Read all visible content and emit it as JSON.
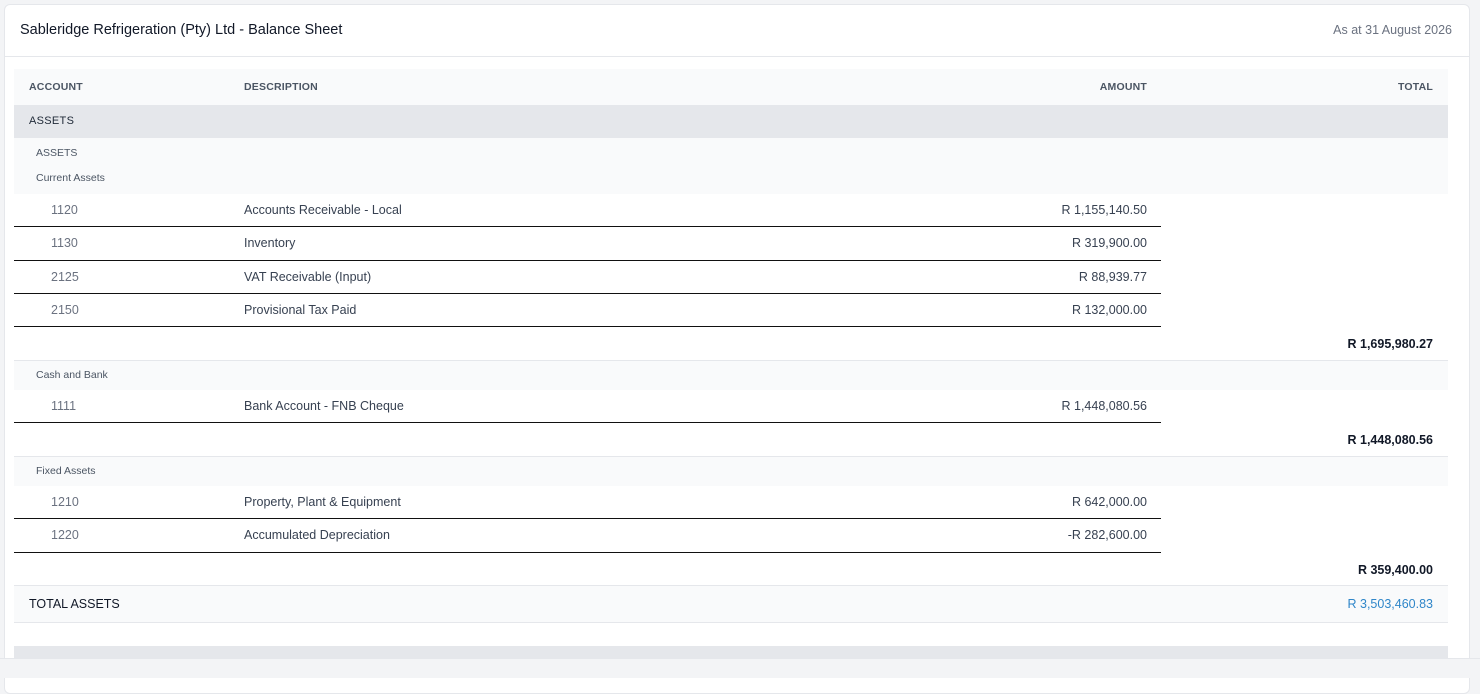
{
  "report": {
    "title": "Sableridge Refrigeration (Pty) Ltd - Balance Sheet",
    "as_at": "As at 31 August 2026"
  },
  "columns": {
    "account": "ACCOUNT",
    "description": "DESCRIPTION",
    "amount": "AMOUNT",
    "total": "TOTAL"
  },
  "assets": {
    "section_label": "ASSETS",
    "group_label": "ASSETS",
    "current": {
      "label": "Current Assets",
      "lines": [
        {
          "account": "1120",
          "description": "Accounts Receivable - Local",
          "amount": "R 1,155,140.50"
        },
        {
          "account": "1130",
          "description": "Inventory",
          "amount": "R 319,900.00"
        },
        {
          "account": "2125",
          "description": "VAT Receivable (Input)",
          "amount": "R 88,939.77"
        },
        {
          "account": "2150",
          "description": "Provisional Tax Paid",
          "amount": "R 132,000.00"
        }
      ],
      "subtotal": "R 1,695,980.27"
    },
    "cash": {
      "label": "Cash and Bank",
      "lines": [
        {
          "account": "1111",
          "description": "Bank Account - FNB Cheque",
          "amount": "R 1,448,080.56"
        }
      ],
      "subtotal": "R 1,448,080.56"
    },
    "fixed": {
      "label": "Fixed Assets",
      "lines": [
        {
          "account": "1210",
          "description": "Property, Plant & Equipment",
          "amount": "R 642,000.00"
        },
        {
          "account": "1220",
          "description": "Accumulated Depreciation",
          "amount": "-R 282,600.00"
        }
      ],
      "subtotal": "R 359,400.00"
    },
    "total_label": "TOTAL ASSETS",
    "total_value": "R 3,503,460.83"
  },
  "colors": {
    "accent": "#2f86c9",
    "section_bg": "#e5e7eb",
    "subtle_bg": "#f9fafb"
  }
}
